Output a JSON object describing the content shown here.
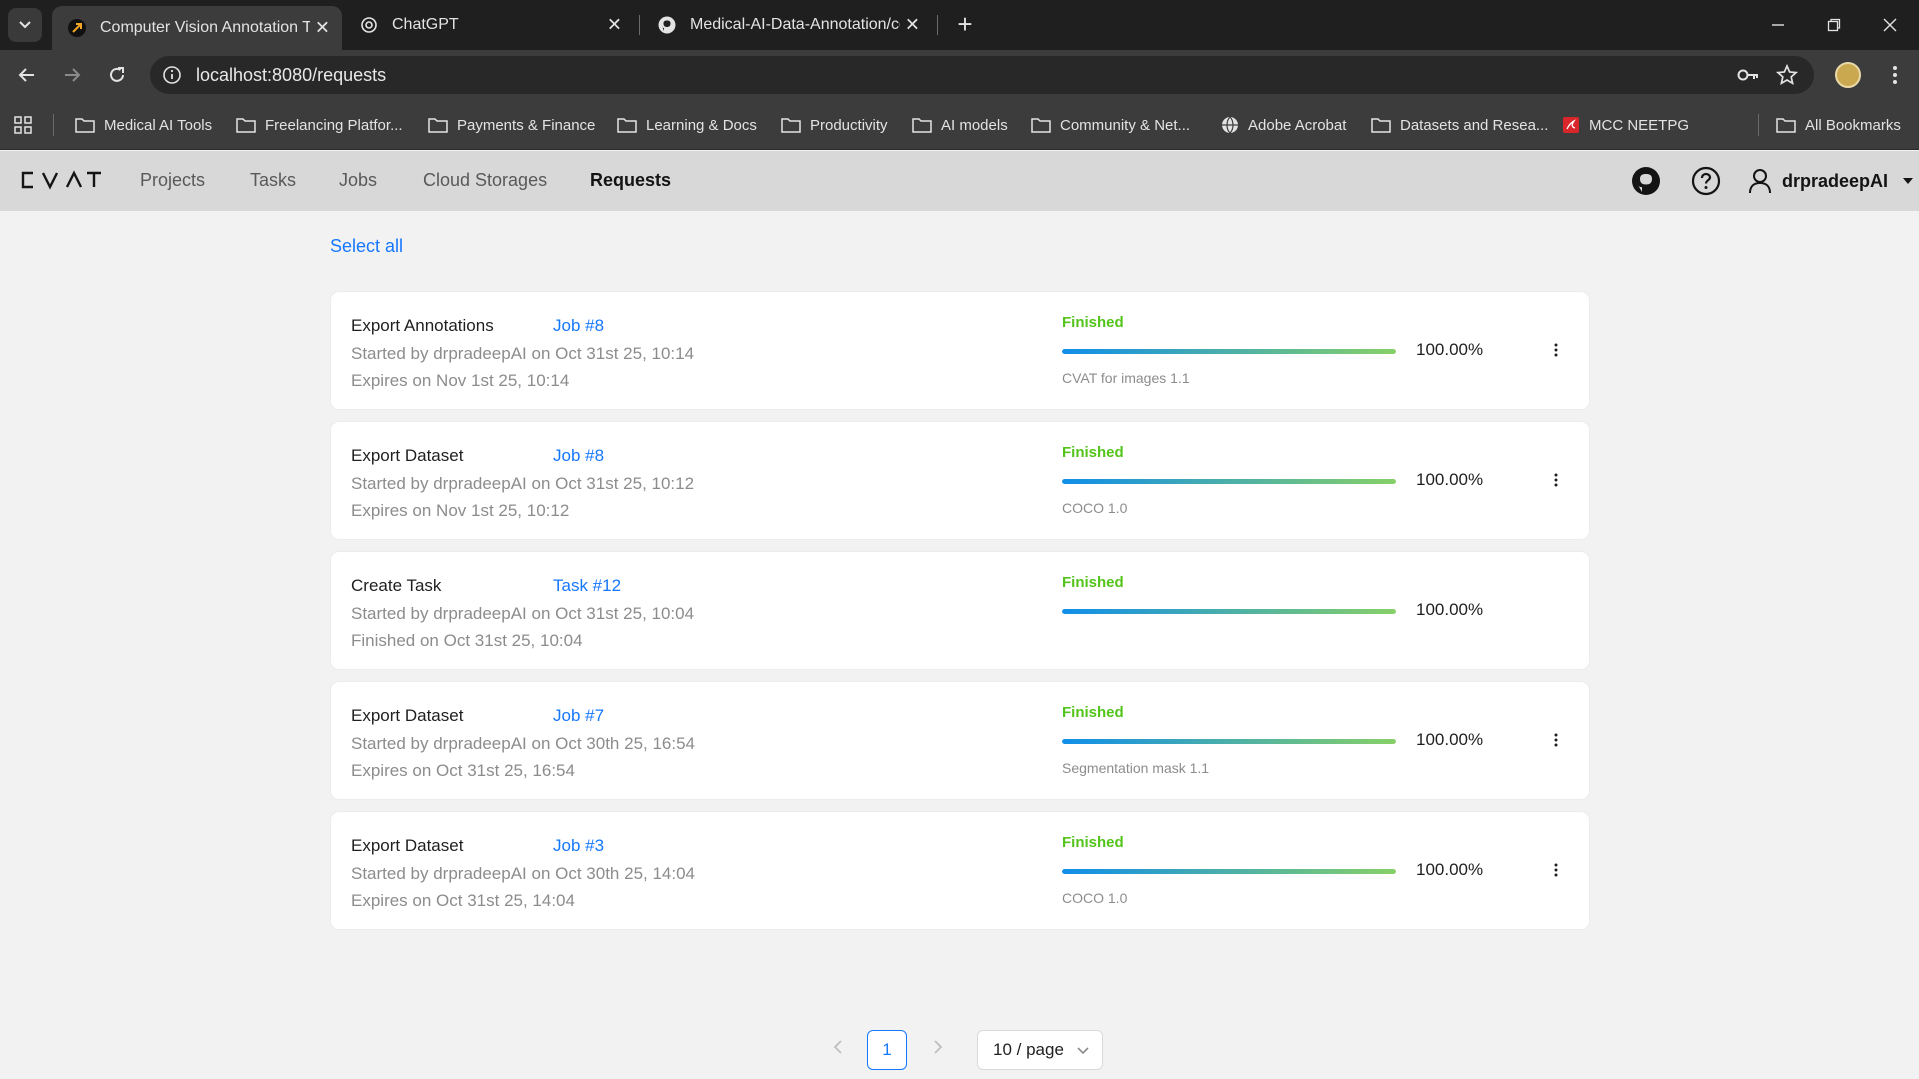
{
  "browser": {
    "tabs": [
      {
        "title": "Computer Vision Annotation To",
        "active": true,
        "icon": "cvat-favicon"
      },
      {
        "title": "ChatGPT",
        "active": false,
        "icon": "openai-icon"
      },
      {
        "title": "Medical-AI-Data-Annotation/co",
        "active": false,
        "icon": "github-icon"
      }
    ],
    "url": "localhost:8080/requests",
    "bookmarks": [
      {
        "label": "Medical AI Tools",
        "icon": "folder-icon"
      },
      {
        "label": "Freelancing Platfor...",
        "icon": "folder-icon"
      },
      {
        "label": "Payments & Finance",
        "icon": "folder-icon"
      },
      {
        "label": "Learning & Docs",
        "icon": "folder-icon"
      },
      {
        "label": "Productivity",
        "icon": "folder-icon"
      },
      {
        "label": "AI models",
        "icon": "folder-icon"
      },
      {
        "label": "Community & Net...",
        "icon": "folder-icon"
      },
      {
        "label": "Adobe Acrobat",
        "icon": "globe-icon"
      },
      {
        "label": "Datasets and Resea...",
        "icon": "folder-icon"
      },
      {
        "label": "MCC NEETPG",
        "icon": "pdf-icon"
      }
    ],
    "all_bookmarks": "All Bookmarks"
  },
  "app": {
    "logo": "CVAT",
    "nav": [
      "Projects",
      "Tasks",
      "Jobs",
      "Cloud Storages",
      "Requests"
    ],
    "active_nav": "Requests",
    "username": "drpradeepAI"
  },
  "content": {
    "select_all": "Select all",
    "requests": [
      {
        "action": "Export Annotations",
        "target": "Job #8",
        "started": "Started by drpradeepAI on Oct 31st 25, 10:14",
        "second_line": "Expires on Nov 1st 25, 10:14",
        "status": "Finished",
        "progress": 1.0,
        "percent": "100.00%",
        "format": "CVAT for images 1.1",
        "has_menu": true
      },
      {
        "action": "Export Dataset",
        "target": "Job #8",
        "started": "Started by drpradeepAI on Oct 31st 25, 10:12",
        "second_line": "Expires on Nov 1st 25, 10:12",
        "status": "Finished",
        "progress": 1.0,
        "percent": "100.00%",
        "format": "COCO 1.0",
        "has_menu": true
      },
      {
        "action": "Create Task",
        "target": "Task #12",
        "started": "Started by drpradeepAI on Oct 31st 25, 10:04",
        "second_line": "Finished on Oct 31st 25, 10:04",
        "status": "Finished",
        "progress": 1.0,
        "percent": "100.00%",
        "format": "",
        "has_menu": false
      },
      {
        "action": "Export Dataset",
        "target": "Job #7",
        "started": "Started by drpradeepAI on Oct 30th 25, 16:54",
        "second_line": "Expires on Oct 31st 25, 16:54",
        "status": "Finished",
        "progress": 1.0,
        "percent": "100.00%",
        "format": "Segmentation mask 1.1",
        "has_menu": true
      },
      {
        "action": "Export Dataset",
        "target": "Job #3",
        "started": "Started by drpradeepAI on Oct 30th 25, 14:04",
        "second_line": "Expires on Oct 31st 25, 14:04",
        "status": "Finished",
        "progress": 1.0,
        "percent": "100.00%",
        "format": "COCO 1.0",
        "has_menu": true
      }
    ]
  },
  "pagination": {
    "current_page": "1",
    "page_size": "10 / page"
  },
  "colors": {
    "link": "#1677ff",
    "success": "#52c41a",
    "progress_from": "#108ee9",
    "progress_to": "#87d068"
  }
}
